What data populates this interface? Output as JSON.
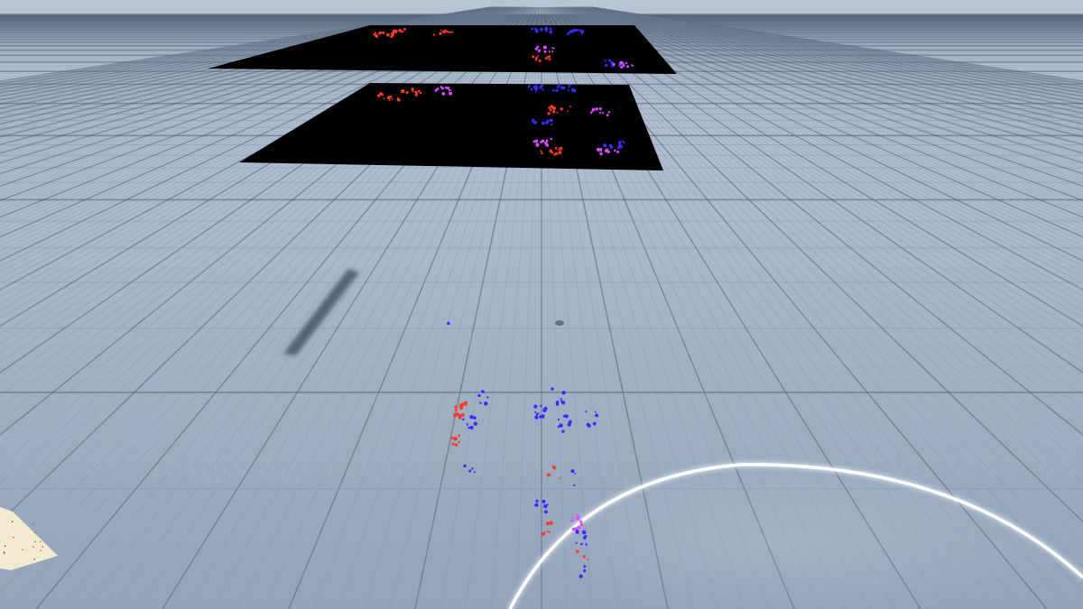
{
  "scene": {
    "description_text": "",
    "colors": {
      "sky_top": "#b9c6d6",
      "horizon": "#c9d3df",
      "ground_far": "#b3c1d2",
      "ground_near": "#8e9fb6",
      "grid_fine": "#7d8ea6",
      "grid_major": "#4f5c70",
      "panel": "#000000",
      "point_red": "#ff3a2a",
      "point_blue": "#3a2cff",
      "point_magenta": "#d84cff",
      "ring_glow": "#ffffff",
      "shadow": "#3d4656",
      "card": "#f4ecd2"
    },
    "objects": [
      {
        "name": "floating-image-panel-far",
        "kind": "black-plane-with-colored-points"
      },
      {
        "name": "floating-image-panel-near",
        "kind": "black-plane-with-colored-points"
      },
      {
        "name": "ground-point-cloud",
        "kind": "red-blue-point-scatter"
      },
      {
        "name": "elongated-shadow",
        "kind": "shadow"
      },
      {
        "name": "glowing-ring-arc",
        "kind": "white-glow-arc"
      },
      {
        "name": "paper-card",
        "kind": "light-card-bottom-left"
      }
    ]
  }
}
